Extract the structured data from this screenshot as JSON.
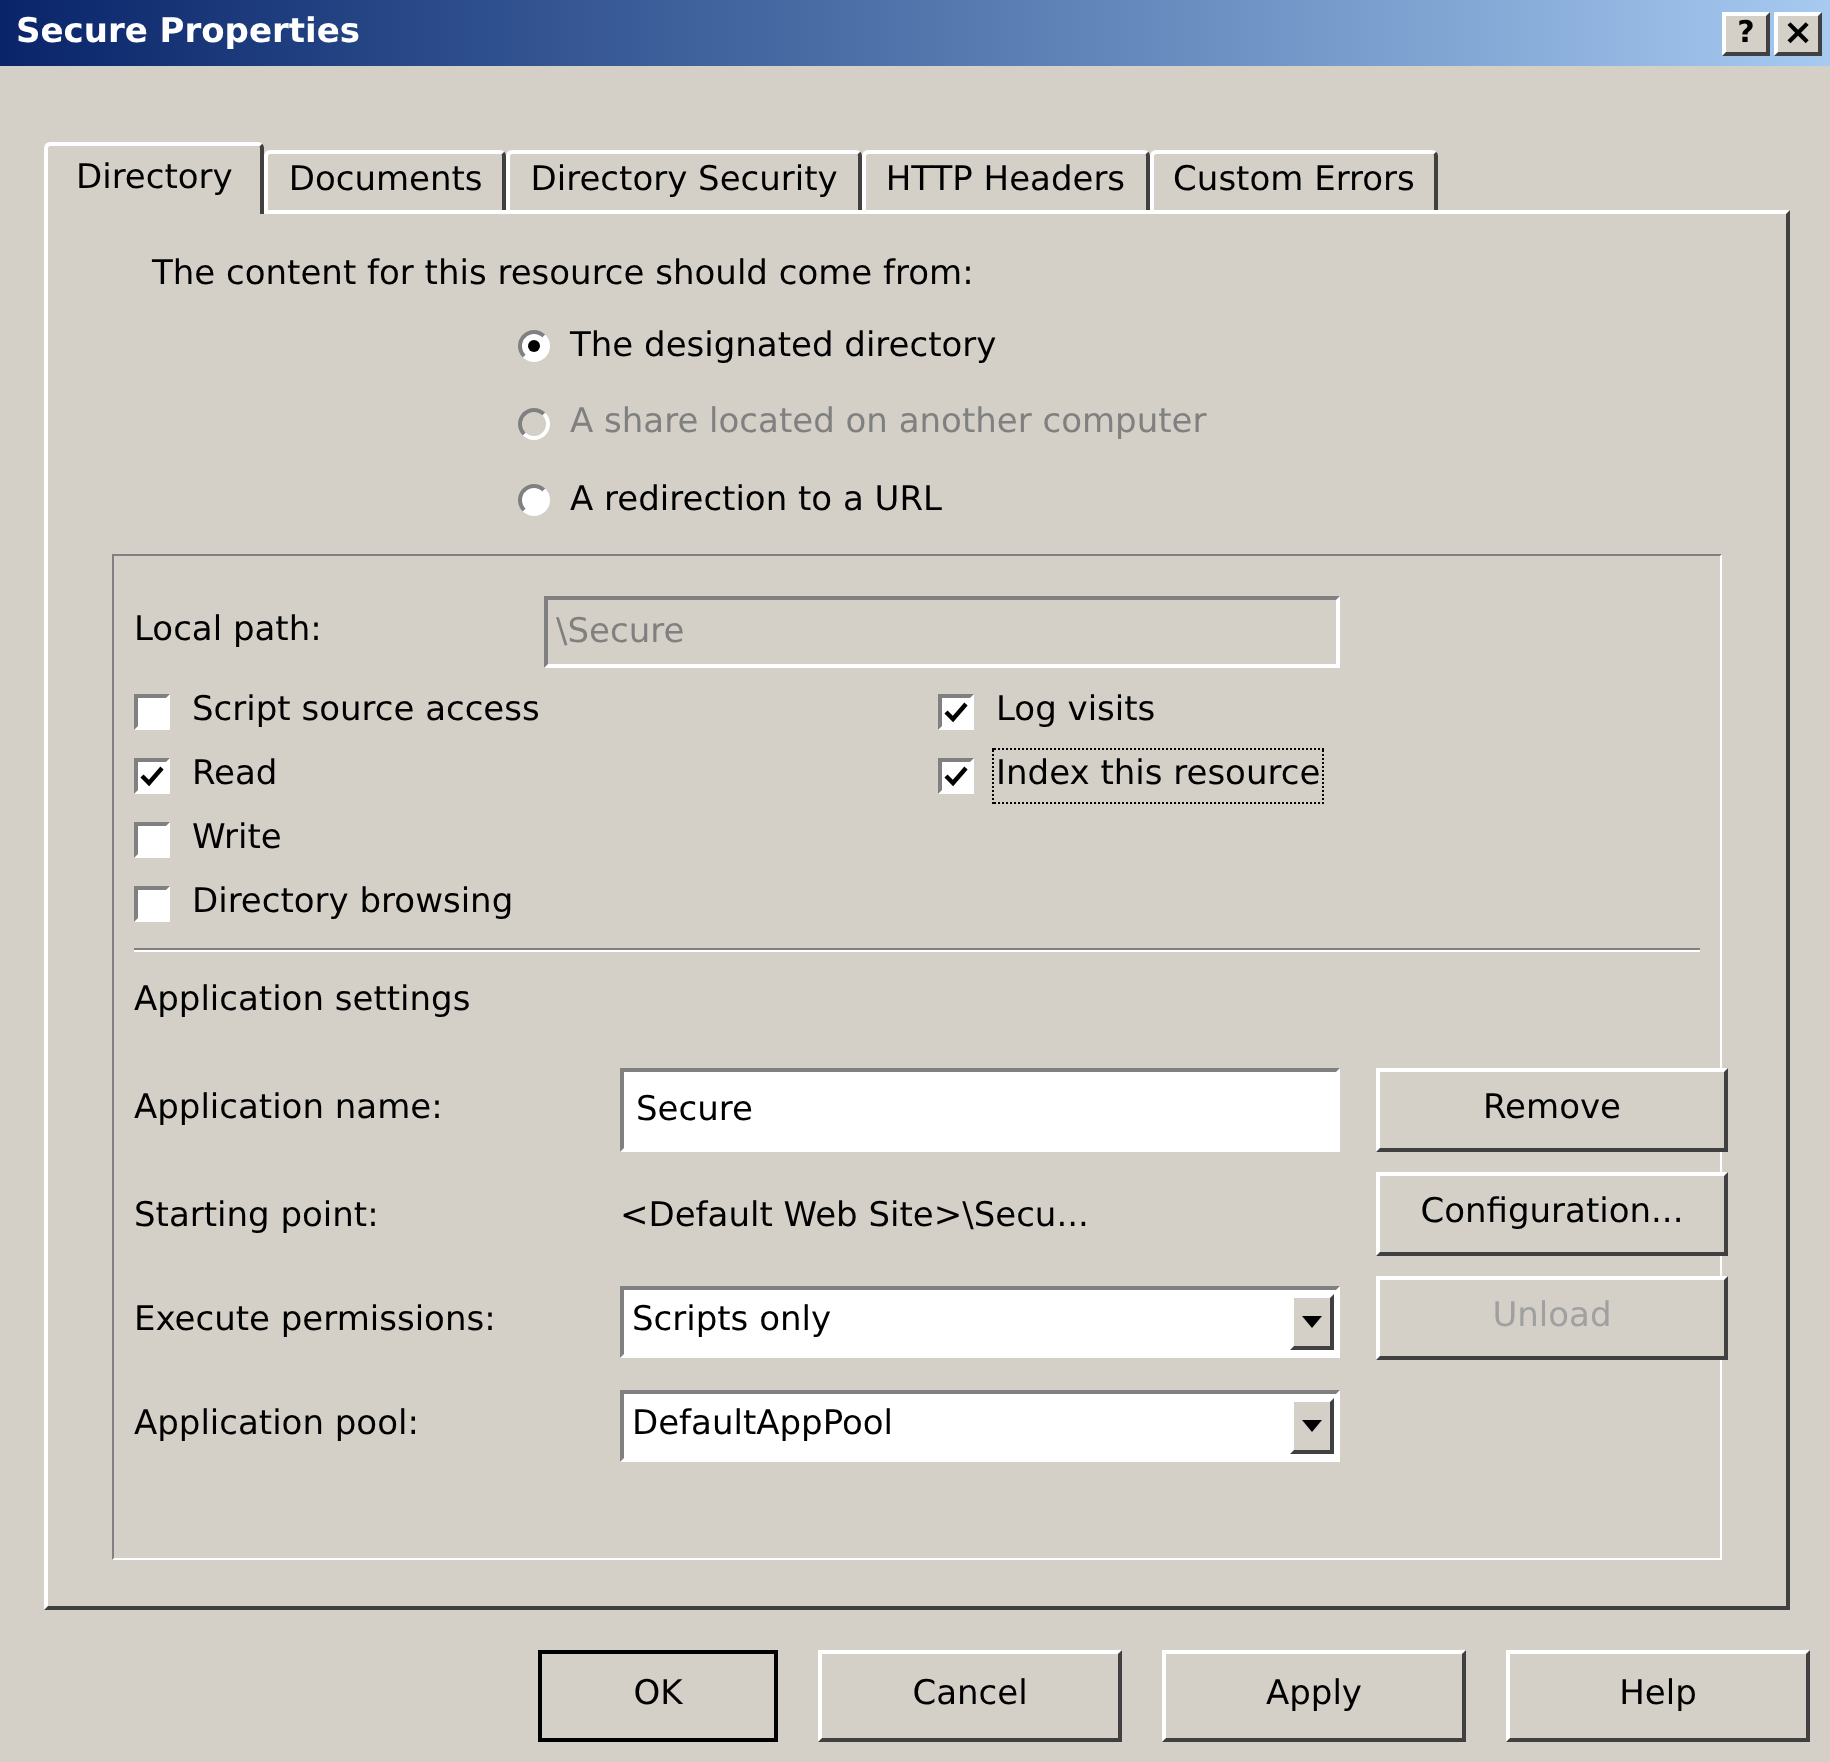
{
  "window": {
    "title": "Secure Properties",
    "help_button": "?",
    "close_button": "×"
  },
  "tabs": [
    {
      "label": "Directory",
      "selected": true
    },
    {
      "label": "Documents",
      "selected": false
    },
    {
      "label": "Directory Security",
      "selected": false
    },
    {
      "label": "HTTP Headers",
      "selected": false
    },
    {
      "label": "Custom Errors",
      "selected": false
    }
  ],
  "content_source": {
    "label": "The content for this resource should come from:",
    "options": [
      {
        "label": "The designated directory",
        "selected": true,
        "disabled": false
      },
      {
        "label": "A share located on another computer",
        "selected": false,
        "disabled": true
      },
      {
        "label": "A redirection to a URL",
        "selected": false,
        "disabled": false
      }
    ]
  },
  "local_path": {
    "label": "Local path:",
    "value": "\\Secure",
    "disabled": true
  },
  "permissions_left": [
    {
      "label": "Script source access",
      "checked": false,
      "focused": false
    },
    {
      "label": "Read",
      "checked": true,
      "focused": false
    },
    {
      "label": "Write",
      "checked": false,
      "focused": false
    },
    {
      "label": "Directory browsing",
      "checked": false,
      "focused": false
    }
  ],
  "permissions_right": [
    {
      "label": "Log visits",
      "checked": true,
      "focused": false
    },
    {
      "label": "Index this resource",
      "checked": true,
      "focused": true
    }
  ],
  "application_settings": {
    "heading": "Application settings",
    "rows": [
      {
        "kind": "input",
        "label": "Application name:",
        "value": "Secure"
      },
      {
        "kind": "text",
        "label": "Starting point:",
        "value": "<Default Web Site>\\Secu..."
      },
      {
        "kind": "dropdown",
        "label": "Execute permissions:",
        "value": "Scripts only"
      },
      {
        "kind": "dropdown",
        "label": "Application pool:",
        "value": "DefaultAppPool"
      }
    ],
    "buttons": [
      {
        "label": "Remove",
        "disabled": false
      },
      {
        "label": "Configuration...",
        "disabled": false
      },
      {
        "label": "Unload",
        "disabled": true
      }
    ]
  },
  "footer_buttons": [
    {
      "label": "OK",
      "disabled": false
    },
    {
      "label": "Cancel",
      "disabled": false
    },
    {
      "label": "Apply",
      "disabled": false
    },
    {
      "label": "Help",
      "disabled": false
    }
  ]
}
